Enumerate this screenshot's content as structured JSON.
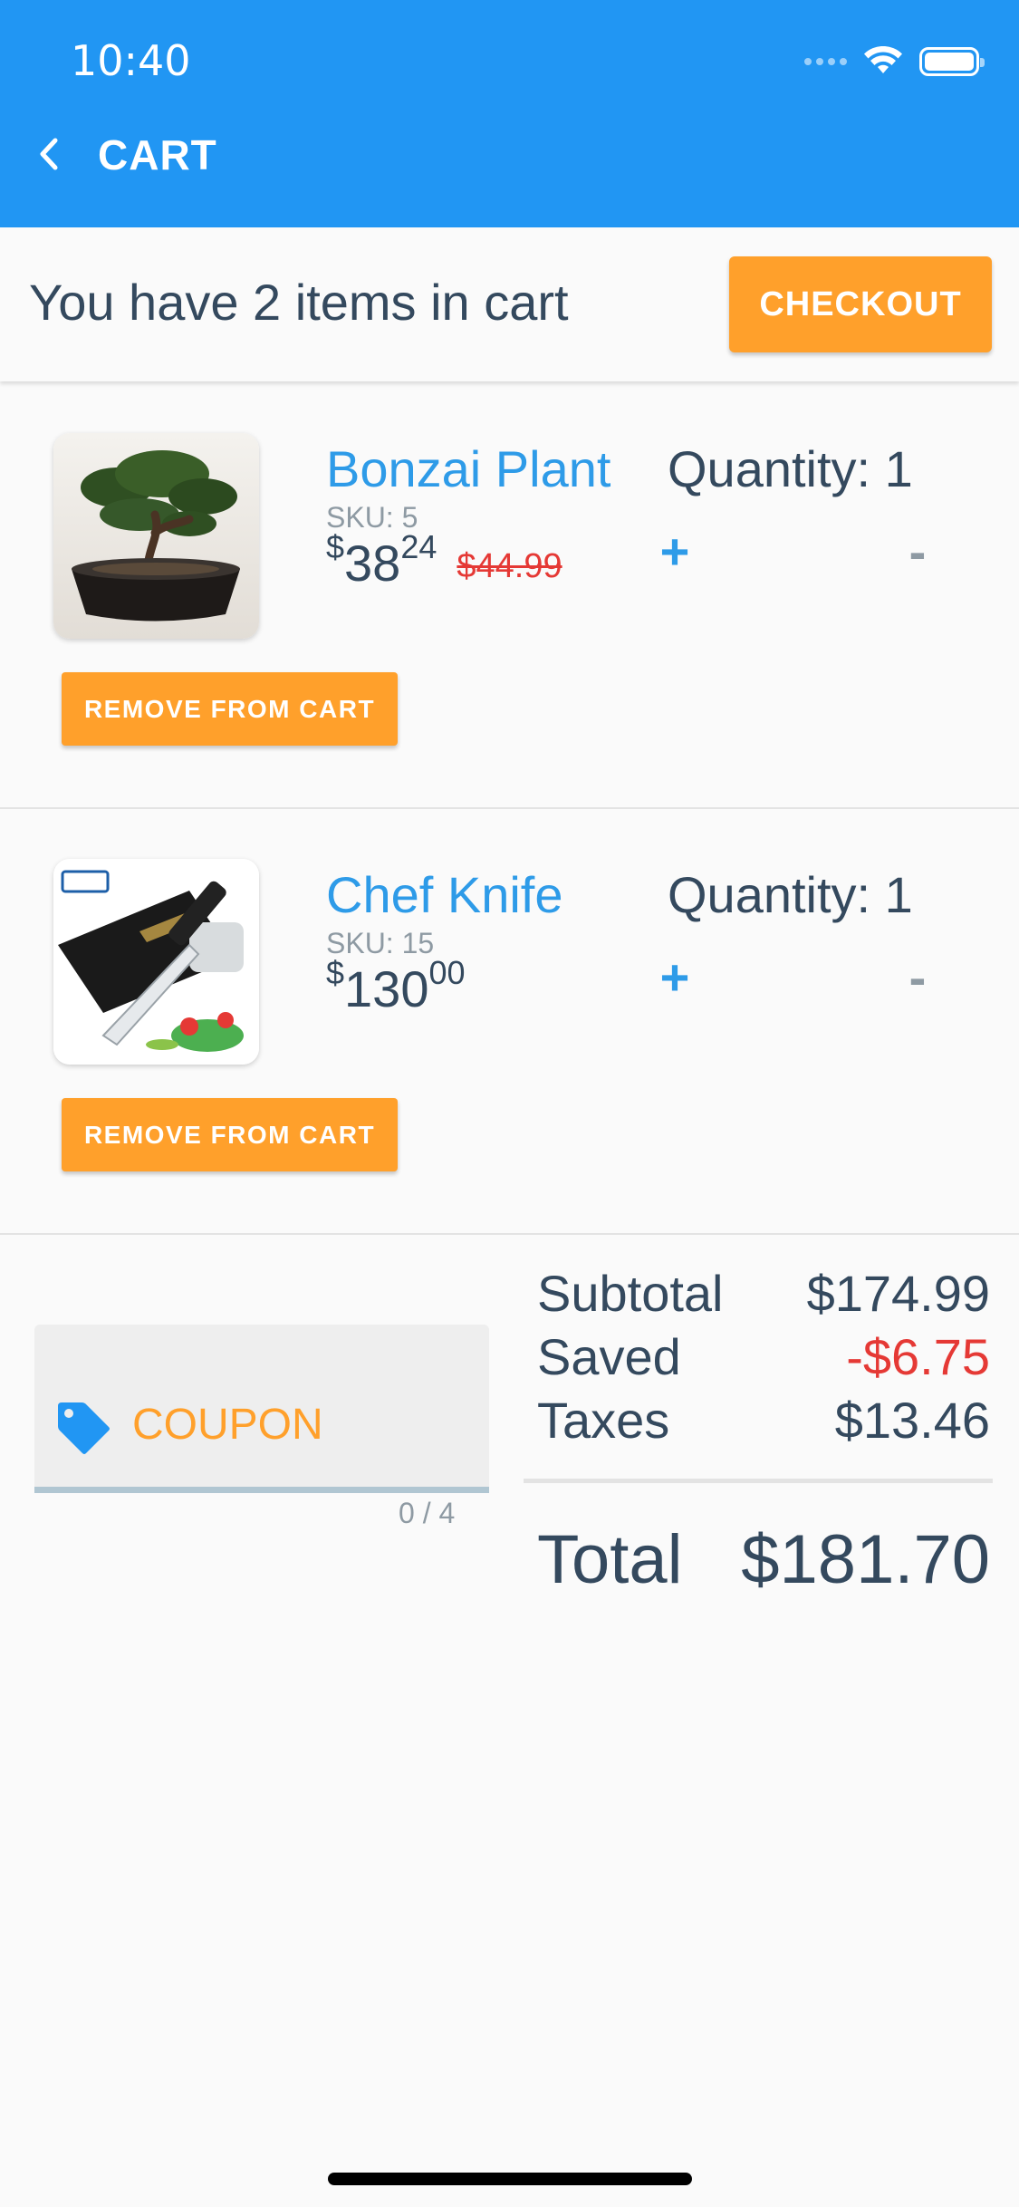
{
  "status_bar": {
    "time": "10:40"
  },
  "nav": {
    "title": "CART",
    "back_icon": "chevron-left-icon"
  },
  "summary": {
    "text": "You have 2 items in cart",
    "checkout_label": "CHECKOUT"
  },
  "items": [
    {
      "name": "Bonzai Plant",
      "sku": "SKU: 5",
      "price_currency": "$",
      "price_whole": "38",
      "price_cents": "24",
      "original_price": "$44.99",
      "quantity_label": "Quantity: 1",
      "plus": "+",
      "minus": "-",
      "remove_label": "REMOVE FROM CART"
    },
    {
      "name": "Chef Knife",
      "sku": "SKU: 15",
      "price_currency": "$",
      "price_whole": "130",
      "price_cents": "00",
      "original_price": "",
      "quantity_label": "Quantity: 1",
      "plus": "+",
      "minus": "-",
      "remove_label": "REMOVE FROM CART"
    }
  ],
  "coupon": {
    "placeholder": "COUPON",
    "counter": "0 / 4",
    "icon": "tag-icon"
  },
  "totals": {
    "subtotal_label": "Subtotal",
    "subtotal_value": "$174.99",
    "saved_label": "Saved",
    "saved_value": "-$6.75",
    "taxes_label": "Taxes",
    "taxes_value": "$13.46",
    "total_label": "Total",
    "total_value": "$181.70"
  },
  "colors": {
    "header": "#2196f3",
    "accent_orange": "#ffa02b",
    "link_blue": "#2e9be8",
    "discount_red": "#e53935",
    "text_dark": "#34495e"
  }
}
